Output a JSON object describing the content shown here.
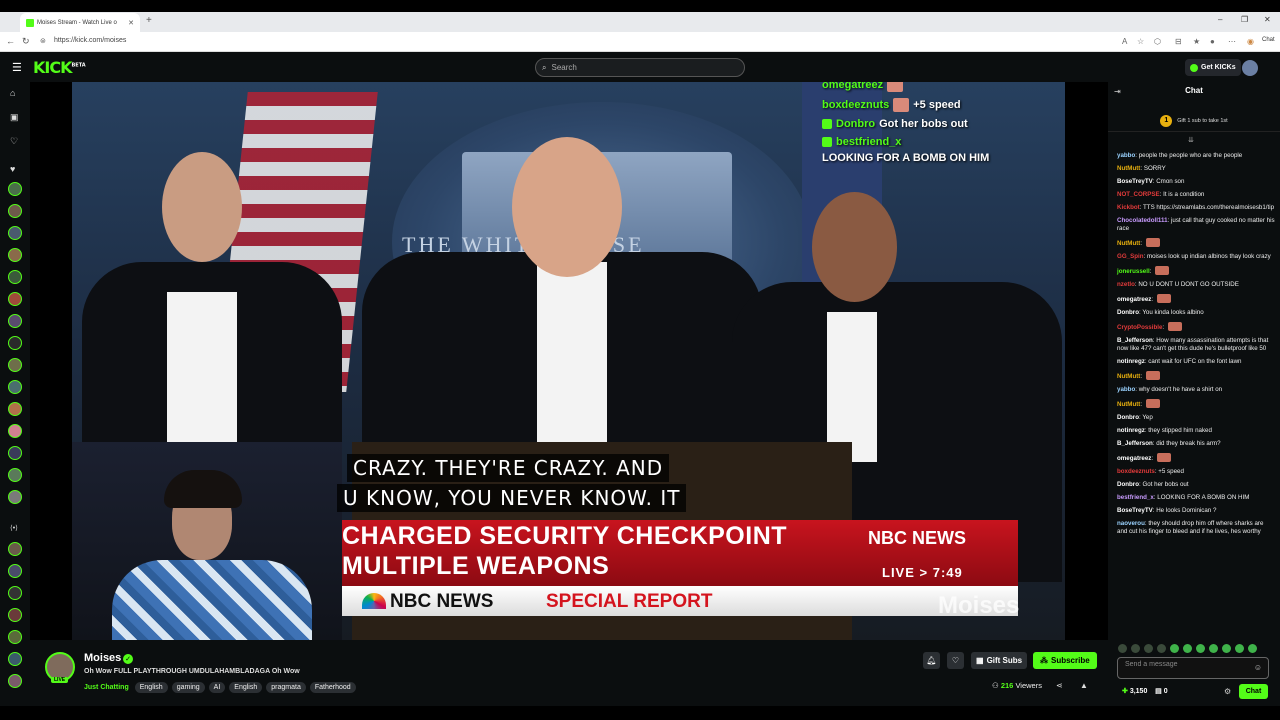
{
  "browser": {
    "tab_title": "Moises Stream - Watch Live o",
    "url": "https://kick.com/moises",
    "chat_label": "Chat"
  },
  "header": {
    "logo": "KICK",
    "logo_sup": "BETA",
    "search_placeholder": "Search",
    "get_kicks": "Get KICKs"
  },
  "video": {
    "overlay_chat": [
      {
        "user": "omegatreez",
        "text": ""
      },
      {
        "user": "boxdeeznuts",
        "text": "+5 speed"
      },
      {
        "user": "Donbro",
        "text": "Got her bobs out"
      },
      {
        "user": "bestfriend_x",
        "text": "LOOKING FOR A BOMB ON HIM"
      }
    ],
    "podium_text": "THE WHITE HOUSE",
    "caption_line1": "CRAZY. THEY'RE CRAZY. AND",
    "caption_line2": "U KNOW, YOU NEVER KNOW. IT",
    "banner_line1": "CHARGED SECURITY CHECKPOINT",
    "banner_line2": "MULTIPLE WEAPONS",
    "banner_network": "NBC NEWS",
    "banner_live": "LIVE > 7:49",
    "report_network": "NBC NEWS",
    "report_label": "SPECIAL REPORT",
    "watermark": "Moises"
  },
  "chat": {
    "title": "Chat",
    "gift_banner": "Gift 1 sub to take 1st",
    "gift_rank": "1",
    "messages": [
      {
        "user": "yabbo",
        "color": "#9bd3ff",
        "text": "people the people who are the people"
      },
      {
        "user": "NutMutt",
        "color": "#e8b00f",
        "text": "SORRY"
      },
      {
        "user": "BoseTreyTV",
        "color": "#ffffff",
        "text": "Cmon son"
      },
      {
        "user": "NOT_CORPSE",
        "color": "#e33b3b",
        "text": "It is a condition"
      },
      {
        "user": "Kickbot",
        "color": "#e33b3b",
        "text": "TTS https://streamlabs.com/therealmoisesb1/tip"
      },
      {
        "user": "Chocolatedoll111",
        "color": "#c99cff",
        "text": "just call that guy cooked no matter his race"
      },
      {
        "user": "NutMutt",
        "color": "#e8b00f",
        "text": ""
      },
      {
        "user": "GG_Spin",
        "color": "#e33b3b",
        "text": "moises look up indian albinos thay look crazy"
      },
      {
        "user": "jonerussell",
        "color": "#53fc18",
        "text": ""
      },
      {
        "user": "nzetlo",
        "color": "#e33b3b",
        "text": "NO U DONT U DONT GO OUTSIDE"
      },
      {
        "user": "omegatreez",
        "color": "#ffffff",
        "text": ""
      },
      {
        "user": "Donbro",
        "color": "#ffffff",
        "text": "You kinda looks albino"
      },
      {
        "user": "CryptoPossible",
        "color": "#e33b3b",
        "text": ""
      },
      {
        "user": "B_Jefferson",
        "color": "#ffffff",
        "text": "How many assassination attempts is that now like 47? can't get this dude he's bulletproof like 50"
      },
      {
        "user": "notinregz",
        "color": "#ffffff",
        "text": "cant wait for UFC on the font lawn"
      },
      {
        "user": "NutMutt",
        "color": "#e8b00f",
        "text": ""
      },
      {
        "user": "yabbo",
        "color": "#9bd3ff",
        "text": "why doesn't he have a shirt on"
      },
      {
        "user": "NutMutt",
        "color": "#e8b00f",
        "text": ""
      },
      {
        "user": "Donbro",
        "color": "#ffffff",
        "text": "Yep"
      },
      {
        "user": "notinregz",
        "color": "#ffffff",
        "text": "they stipped him naked"
      },
      {
        "user": "B_Jefferson",
        "color": "#ffffff",
        "text": "did they break his arm?"
      },
      {
        "user": "omegatreez",
        "color": "#ffffff",
        "text": ""
      },
      {
        "user": "boxdeeznuts",
        "color": "#e33b3b",
        "text": "+5 speed"
      },
      {
        "user": "Donbro",
        "color": "#ffffff",
        "text": "Got her bobs out"
      },
      {
        "user": "bestfriend_x",
        "color": "#c99cff",
        "text": "LOOKING FOR A BOMB ON HIM"
      },
      {
        "user": "BoseTreyTV",
        "color": "#ffffff",
        "text": "He looks Dominican ?"
      },
      {
        "user": "naoverou",
        "color": "#9bd3ff",
        "text": "they should drop him off where sharks are and cut his finger to bleed and if he lives, hes worthy"
      }
    ],
    "send_placeholder": "Send a message",
    "kicks_balance": "3,150",
    "gifts_count": "0",
    "chat_button": "Chat"
  },
  "channel": {
    "name": "Moises",
    "live_badge": "LIVE",
    "stream_title": "Oh Wow FULL PLAYTHROUGH UMDULAHAMBLADAGA Oh Wow",
    "category": "Just Chatting",
    "tags": [
      "English",
      "gaming",
      "AI",
      "English",
      "pragmata",
      "Fatherhood"
    ],
    "gift_subs": "Gift Subs",
    "subscribe": "Subscribe",
    "viewers_count": "216",
    "viewers_label": "Viewers"
  }
}
